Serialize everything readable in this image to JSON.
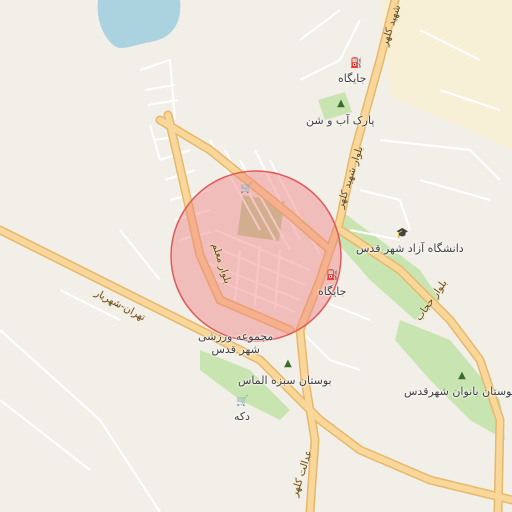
{
  "map": {
    "colors": {
      "background": "#f2efe9",
      "water": "#aad3df",
      "park": "#c8e4b0",
      "major_road": "#f9d79a",
      "major_road_casing": "#e6b86a",
      "minor_road": "#ffffff",
      "highlight_fill": "#f08080",
      "highlight_stroke": "#e05a5a",
      "urban_tint": "#f7efd6"
    },
    "labels": {
      "gas_station_top": "جایگاه",
      "park_ab_o_shen": "پارک آب و شن",
      "university": "دانشگاه آزاد شهر قدس",
      "gas_station_mid": "جایگاه",
      "sports_complex_line1": "مجموعه ورزشی",
      "sports_complex_line2": "شهر قدس",
      "bustan_sabze": "بوستان سبزه الماس",
      "bustan_banovan": "بوستان بانوان شهرقدس",
      "shop": "دکه",
      "road_tehran_shahriar": "تهران-شهریار",
      "road_moallem": "بلوار معلم",
      "road_shahid_kalhor": "بلوار شهید کلهر",
      "road_hejab": "بلوار حجاب",
      "road_kalhor_top": "شهید کلهر",
      "road_kalhor_bottom": "عدالت کلهر"
    },
    "icons": {
      "gas": "fuel-pump-icon",
      "park": "tree-icon",
      "university": "graduation-cap-icon",
      "shop": "shopping-cart-icon"
    }
  }
}
